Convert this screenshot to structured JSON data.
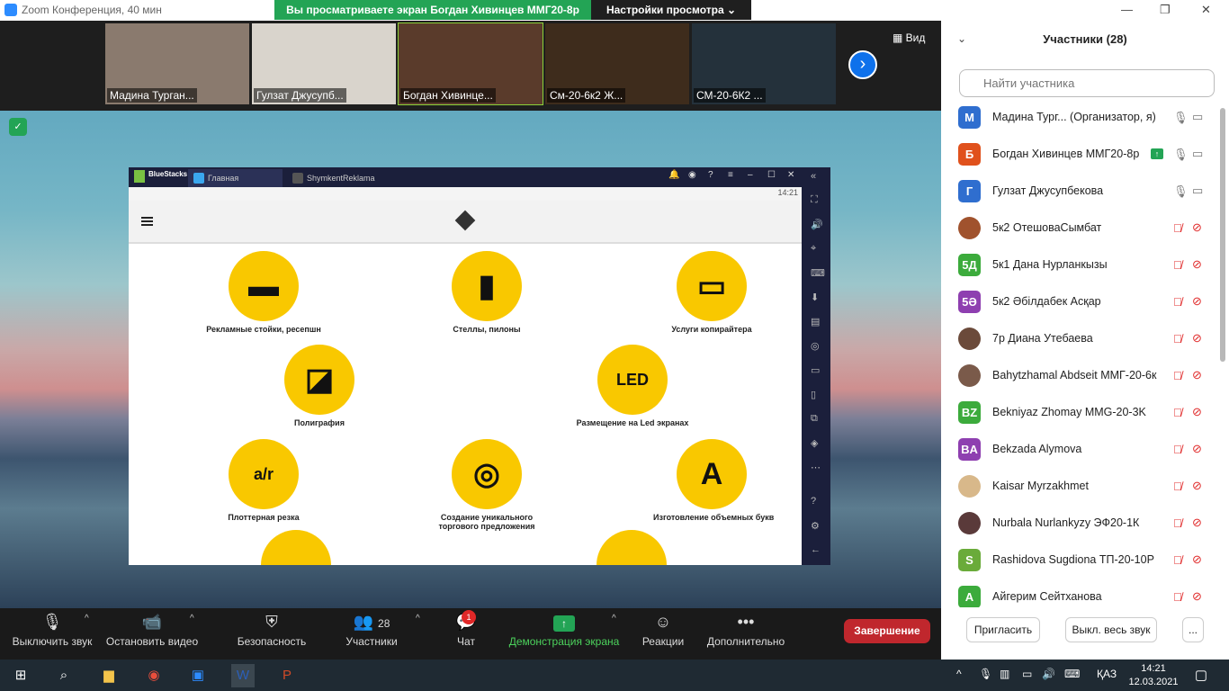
{
  "window": {
    "title": "Zoom Конференция, 40 мин"
  },
  "banner": {
    "sharing_text": "Вы просматриваете экран Богдан Хивинцев ММГ20-8р",
    "view_settings": "Настройки просмотра ⌄"
  },
  "gallery": {
    "thumbs": [
      {
        "name": "Мадина Турган...",
        "bg": "#8a7a6e"
      },
      {
        "name": "Гулзат Джусупб...",
        "bg": "#d9d4cc"
      },
      {
        "name": "Богдан Хивинце...",
        "bg": "#5a3b2b"
      },
      {
        "name": "См-20-6к2 Ж...",
        "bg": "#3e2c1c"
      },
      {
        "name": "СМ-20-6К2 ...",
        "bg": "#24313b"
      }
    ],
    "view_label": "Вид"
  },
  "bluestacks": {
    "logo": "BlueStacks",
    "tab_home": "Главная",
    "tab_app": "ShymkentReklama",
    "time": "14:21"
  },
  "services": [
    {
      "label": "Рекламные стойки, ресепшн",
      "glyph": "▬"
    },
    {
      "label": "Стеллы, пилоны",
      "glyph": "▮"
    },
    {
      "label": "Услуги копирайтера",
      "glyph": "▭"
    },
    {
      "label": "Полиграфия",
      "glyph": "◪"
    },
    {
      "label": "Размещение на Led экранах",
      "glyph": "LED"
    },
    {
      "label": "Плоттерная резка",
      "glyph": "a/r"
    },
    {
      "label": "Создание уникального торгового предложения",
      "glyph": "◎"
    },
    {
      "label": "Изготовление объемных букв",
      "glyph": "A"
    }
  ],
  "controls": {
    "mute": "Выключить звук",
    "video": "Остановить видео",
    "security": "Безопасность",
    "participants": "Участники",
    "participants_count": "28",
    "chat": "Чат",
    "chat_badge": "1",
    "share": "Демонстрация экрана",
    "reactions": "Реакции",
    "more": "Дополнительно",
    "end": "Завершение"
  },
  "panel": {
    "title": "Участники (28)",
    "search_placeholder": "Найти участника",
    "participants": [
      {
        "initials": "М",
        "color": "#2f6ecf",
        "name": "Мадина Тург...  (Организатор, я)",
        "muted": false
      },
      {
        "initials": "Б",
        "color": "#e0511c",
        "name": "Богдан Хивинцев ММГ20-8р",
        "muted": false
      },
      {
        "initials": "Г",
        "color": "#2f6ecf",
        "name": "Гулзат Джусупбекова",
        "muted": false
      },
      {
        "initials": "",
        "color": "#a0522d",
        "name": "5к2 ОтешоваСымбат",
        "muted": true
      },
      {
        "initials": "5Д",
        "color": "#3cab3c",
        "name": "5к1 Дана Нурланкызы",
        "muted": true
      },
      {
        "initials": "5Ә",
        "color": "#8e3fb0",
        "name": "5к2 Әбілдабек Асқар",
        "muted": true
      },
      {
        "initials": "",
        "color": "#6b4a3a",
        "name": "7р Диана Утебаева",
        "muted": true
      },
      {
        "initials": "",
        "color": "#7a5a4a",
        "name": "Bahytzhamal Abdseit ММГ-20-6к",
        "muted": true
      },
      {
        "initials": "BZ",
        "color": "#3cab3c",
        "name": "Bekniyaz Zhomay MMG-20-3K",
        "muted": true
      },
      {
        "initials": "BA",
        "color": "#8e3fb0",
        "name": "Bekzada Alymova",
        "muted": true
      },
      {
        "initials": "",
        "color": "#d8b88a",
        "name": "Kaisar Myrzakhmet",
        "muted": true
      },
      {
        "initials": "",
        "color": "#5a3a3a",
        "name": "Nurbala Nurlankyzy ЭФ20-1К",
        "muted": true
      },
      {
        "initials": "S",
        "color": "#6aab3a",
        "name": "Rashidova Sugdiona ТП-20-10Р",
        "muted": true
      },
      {
        "initials": "А",
        "color": "#3cab3c",
        "name": "Айгерим Сейтханова",
        "muted": true
      }
    ],
    "invite": "Пригласить",
    "mute_all": "Выкл. весь звук",
    "more": "..."
  },
  "taskbar": {
    "lang": "ҚАЗ",
    "time": "14:21",
    "date": "12.03.2021"
  }
}
